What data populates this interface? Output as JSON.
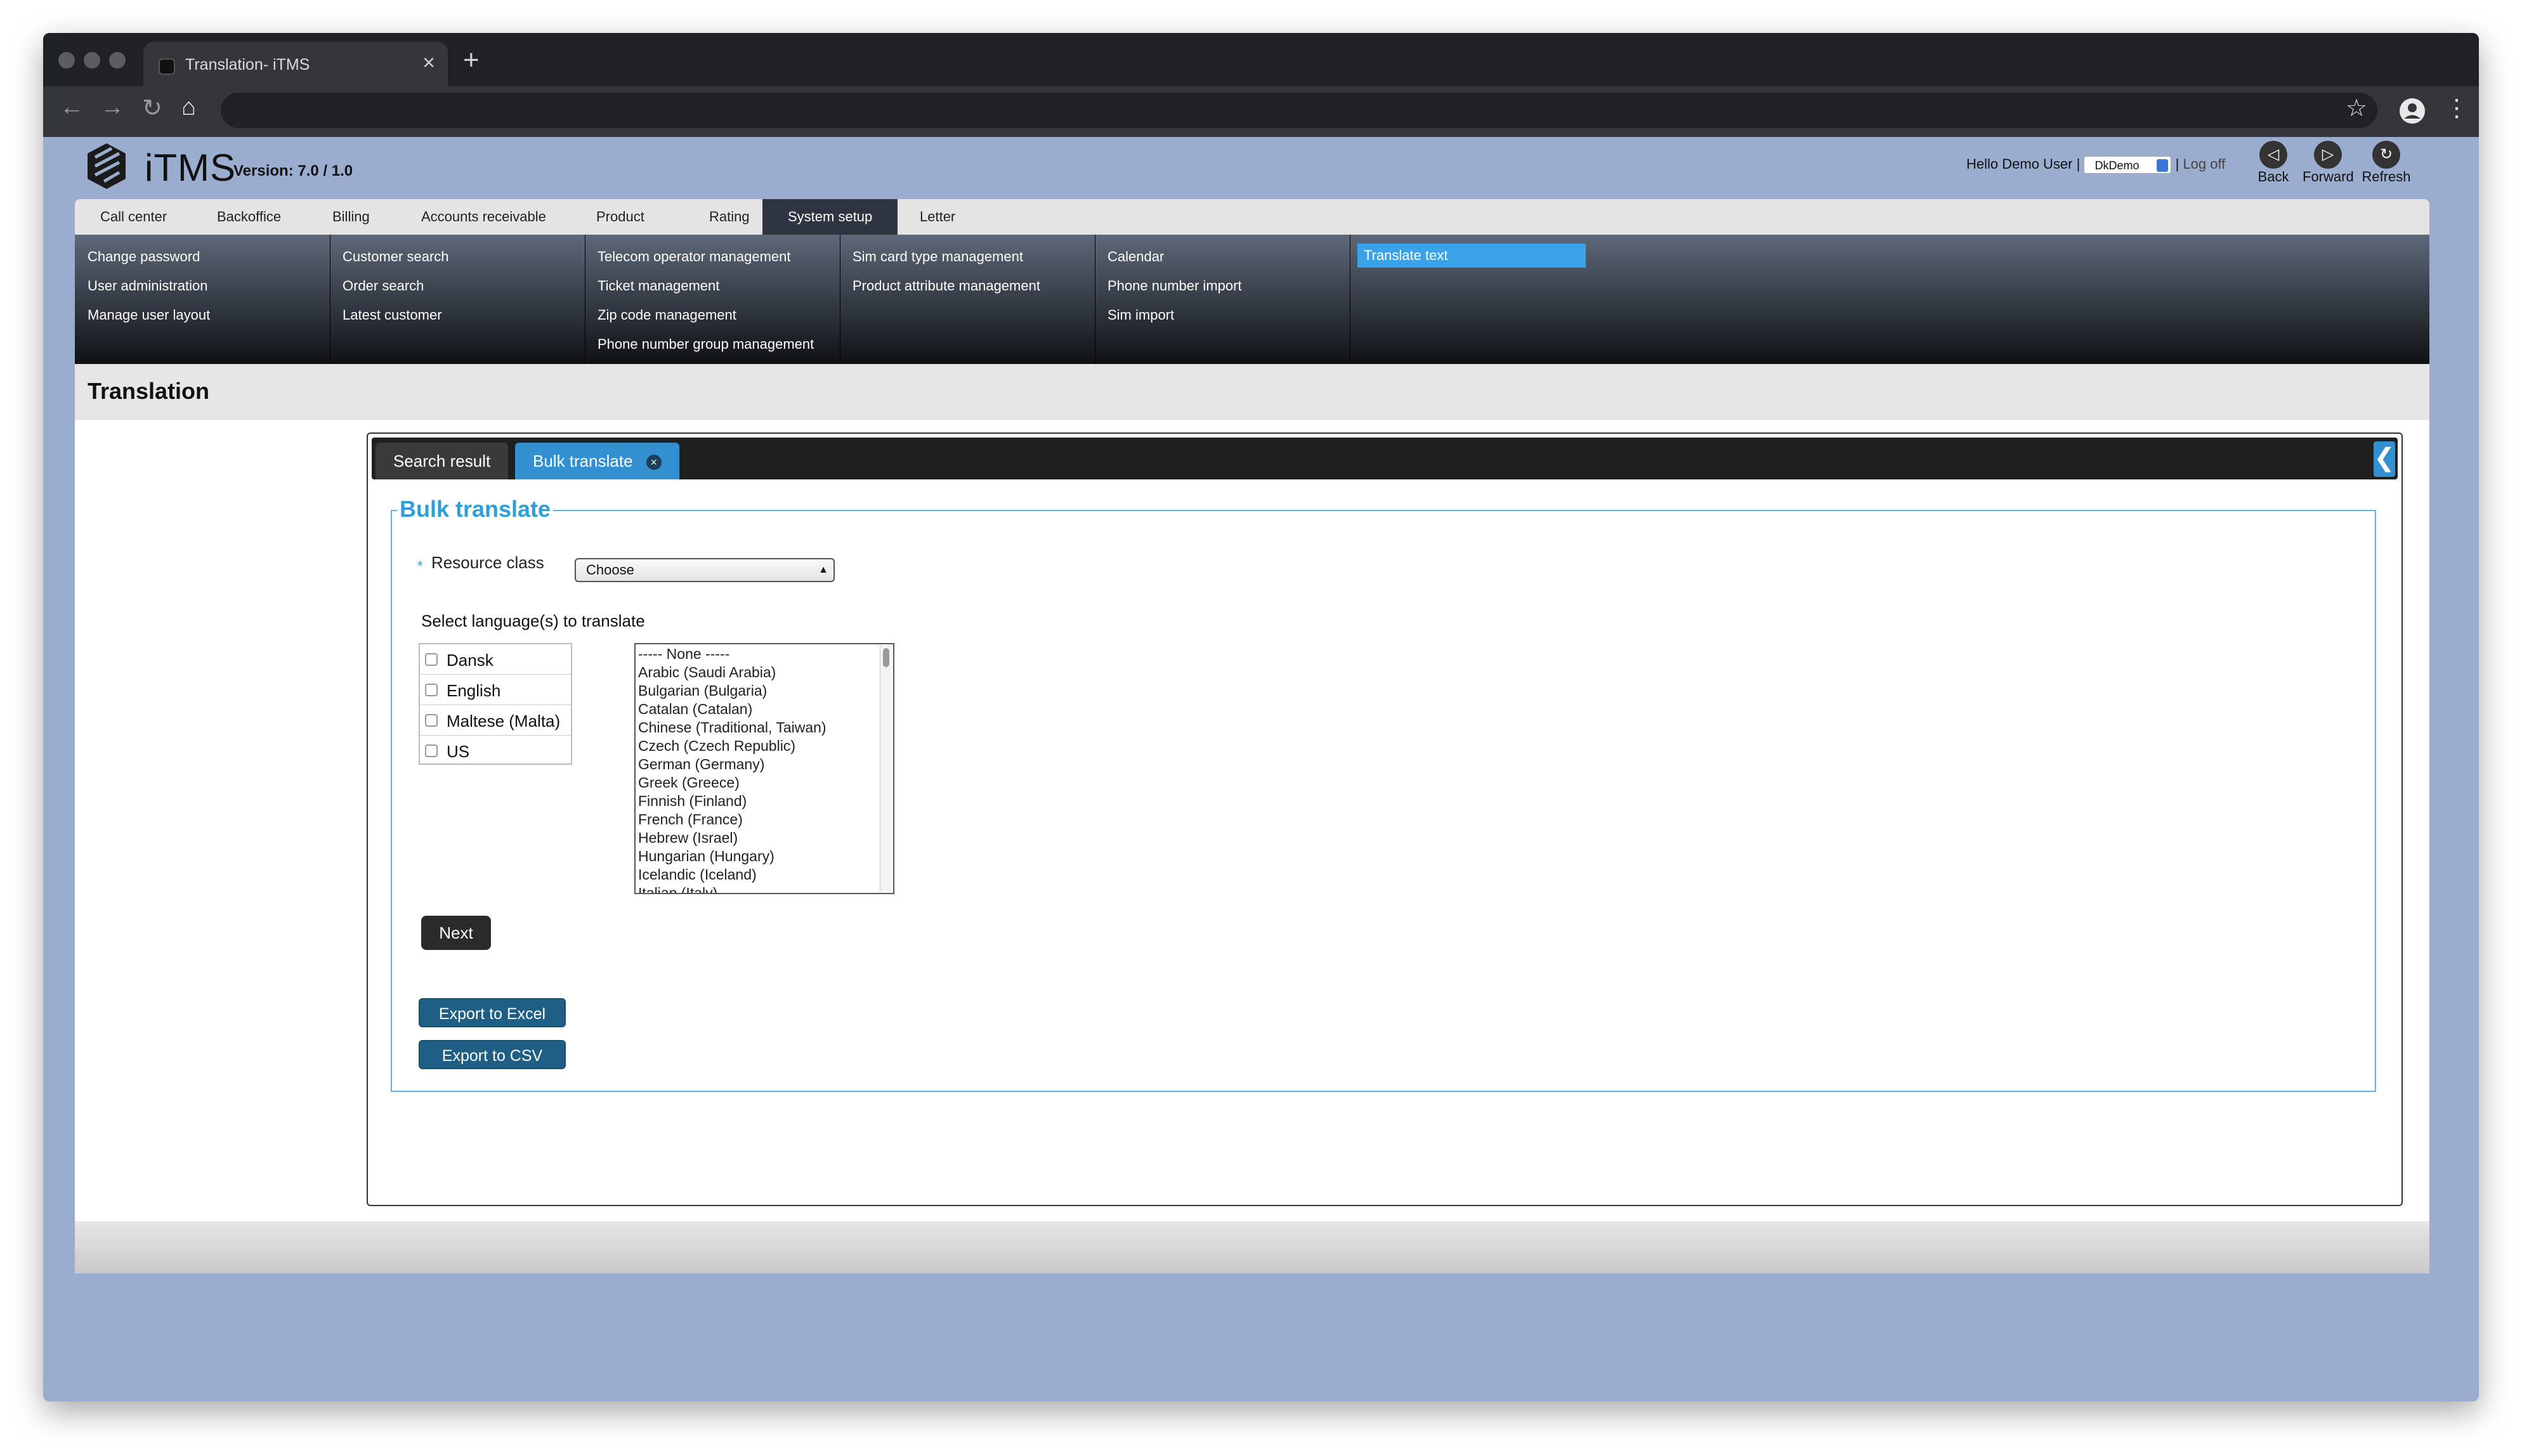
{
  "browser": {
    "tab_title": "Translation- iTMS",
    "tab_close": "×",
    "new_tab": "+",
    "back": "←",
    "forward": "→",
    "reload": "↻",
    "home": "⌂",
    "bookmark": "☆",
    "menu": "⋮"
  },
  "app": {
    "brand": "iTMS",
    "version": "Version: 7.0 / 1.0",
    "greeting": "Hello Demo User",
    "separator": "|",
    "customer_selected": "DkDemo",
    "logoff": "Log off",
    "nav": {
      "back": "Back",
      "forward": "Forward",
      "refresh": "Refresh"
    }
  },
  "menu": {
    "tabs": [
      "Call center",
      "Backoffice",
      "Billing",
      "Accounts receivable",
      "Product",
      "Rating",
      "System setup",
      "Letter"
    ],
    "active_tab": "System setup",
    "columns": [
      [
        "Change password",
        "User administration",
        "Manage user layout"
      ],
      [
        "Customer search",
        "Order search",
        "Latest customer"
      ],
      [
        "Telecom operator management",
        "Ticket management",
        "Zip code management",
        "Phone number group management"
      ],
      [
        "Sim card type management",
        "Product attribute management"
      ],
      [
        "Calendar",
        "Phone number import",
        "Sim import"
      ],
      [
        "Translate text"
      ]
    ],
    "active_item": "Translate text"
  },
  "page": {
    "title": "Translation",
    "tabs": [
      "Search result",
      "Bulk translate"
    ],
    "active_tab": "Bulk translate",
    "tab_close": "×",
    "collapse": "❮"
  },
  "form": {
    "legend": "Bulk translate",
    "required_star": "*",
    "resource_class_label": "Resource class",
    "resource_class_value": "Choose",
    "select_languages_label": "Select language(s) to translate",
    "languages": [
      "Dansk",
      "English",
      "Maltese (Malta)",
      "US"
    ],
    "available_languages": [
      "----- None -----",
      "Arabic (Saudi Arabia)",
      "Bulgarian (Bulgaria)",
      "Catalan (Catalan)",
      "Chinese (Traditional, Taiwan)",
      "Czech (Czech Republic)",
      "German (Germany)",
      "Greek (Greece)",
      "Finnish (Finland)",
      "French (France)",
      "Hebrew (Israel)",
      "Hungarian (Hungary)",
      "Icelandic (Iceland)",
      "Italian (Italy)"
    ],
    "next": "Next",
    "export_excel": "Export to Excel",
    "export_csv": "Export to CSV"
  }
}
